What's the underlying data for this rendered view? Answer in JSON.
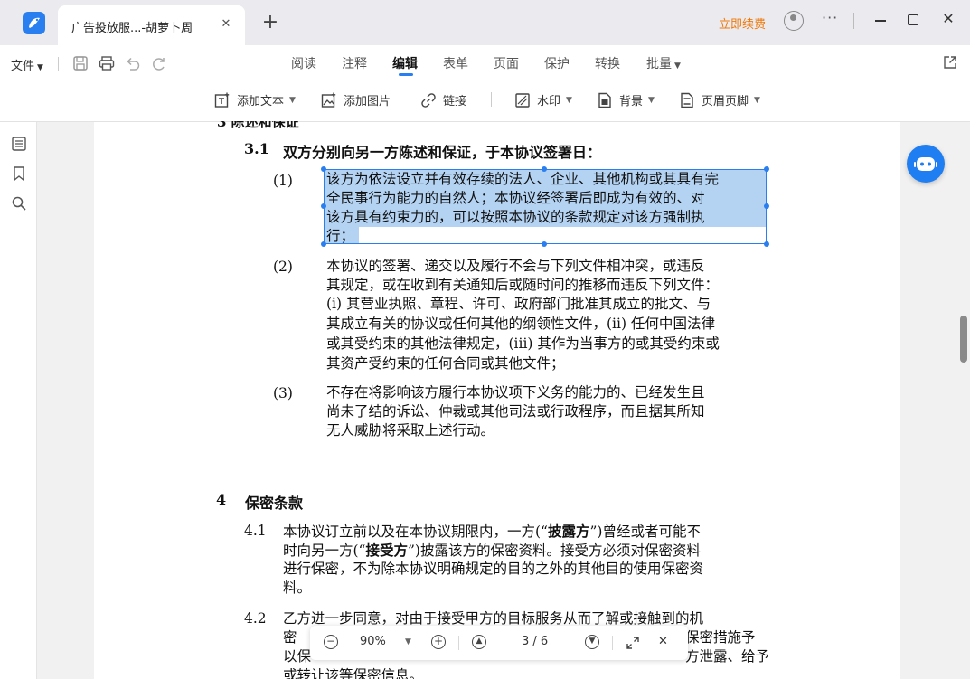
{
  "window": {
    "tab_title": "广告投放服...-胡萝卜周",
    "tab_close": "✕",
    "new_tab": "+",
    "upgrade_label": "立即续费",
    "more_label": "···",
    "close_label": "✕"
  },
  "toolbar": {
    "file_menu": "文件",
    "menu_tabs": [
      "阅读",
      "注释",
      "编辑",
      "表单",
      "页面",
      "保护",
      "转换",
      "批量"
    ],
    "active_tab": "编辑",
    "sub_items": {
      "add_text": "添加文本",
      "add_image": "添加图片",
      "link": "链接",
      "watermark": "水印",
      "background": "背景",
      "header_footer": "页眉页脚"
    }
  },
  "document": {
    "top_partial": "3    陈述和保证",
    "section_3_1": {
      "num": "3.1",
      "title": "双方分别向另一方陈述和保证，于本协议签署日："
    },
    "clauses": [
      {
        "num": "(1)",
        "lines": [
          "该方为依法设立并有效存续的法人、企业、其他机构或其具有完",
          "全民事行为能力的自然人；本协议经签署后即成为有效的、对",
          "该方具有约束力的，可以按照本协议的条款规定对该方强制执",
          "行；"
        ]
      },
      {
        "num": "(2)",
        "lines": [
          "本协议的签署、递交以及履行不会与下列文件相冲突，或违反",
          "其规定，或在收到有关通知后或随时间的推移而违反下列文件：",
          "(i) 其营业执照、章程、许可、政府部门批准其成立的批文、与",
          "其成立有关的协议或任何其他的纲领性文件，(ii) 任何中国法律",
          "或其受约束的其他法律规定，(iii) 其作为当事方的或其受约束或",
          "其资产受约束的任何合同或其他文件；"
        ]
      },
      {
        "num": "(3)",
        "lines": [
          "不存在将影响该方履行本协议项下义务的能力的、已经发生且",
          "尚未了结的诉讼、仲裁或其他司法或行政程序，而且据其所知",
          "无人威胁将采取上述行动。"
        ]
      }
    ],
    "section_4": {
      "num": "4",
      "title": "保密条款"
    },
    "clause_4_1": {
      "num": "4.1",
      "line1_a": "本协议订立前以及在本协议期限内，一方(“",
      "line1_b": "披露方",
      "line1_c": "”)曾经或者可能不",
      "line2_a": "时向另一方(“",
      "line2_b": "接受方",
      "line2_c": "”)披露该方的保密资料。接受方必须对保密资料",
      "line3": "进行保密，不为除本协议明确规定的目的之外的其他目的使用保密资",
      "line4": "料。"
    },
    "clause_4_2": {
      "num": "4.2",
      "line1": "乙方进一步同意，对由于接受甲方的目标服务从而了解或接触到的机",
      "line2_a": "密",
      "line2_b": "保密措施予",
      "line3_a": "以保",
      "line3_b": "方泄露、给予",
      "line4": "或转让该等保密信息。"
    }
  },
  "navbar": {
    "zoom": "90%",
    "page": "3 / 6"
  }
}
